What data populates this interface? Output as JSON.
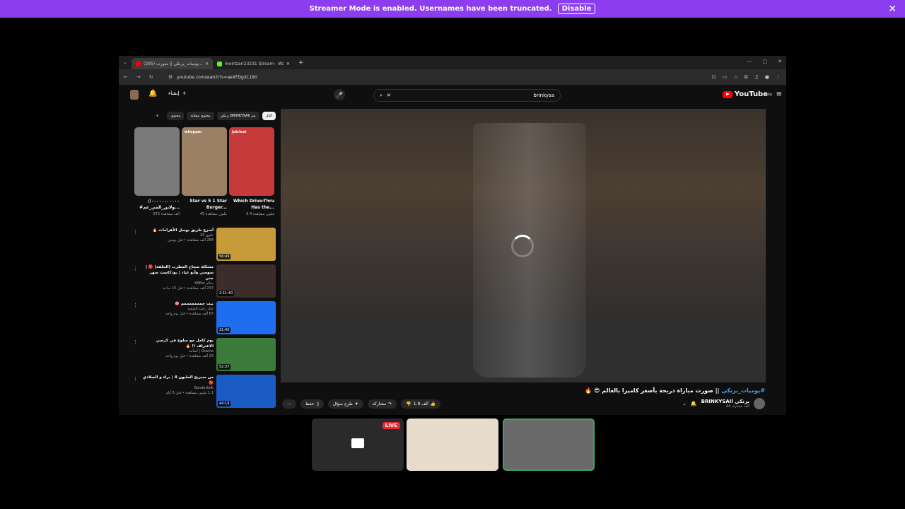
{
  "banner": {
    "text": "Streamer Mode is enabled. Usernames have been truncated.",
    "button": "Disable",
    "close": "✕",
    "color": "#8d3df0"
  },
  "browser": {
    "tabs": [
      {
        "title": "(295) يوميات_برنكي || صورت...",
        "icon_color": "#ff0000"
      },
      {
        "title": "montzari23231 Stream - Wa...",
        "icon_color": "#53fc18"
      }
    ],
    "new_tab": "+",
    "url": "youtube.com/watch?v=aeXFDgXL190",
    "controls": {
      "minimize": "—",
      "maximize": "▢",
      "close": "✕"
    }
  },
  "youtube": {
    "logo": "YouTube",
    "logo_sup": "SA",
    "search_query": "brinkysa",
    "create_label": "إنشاء",
    "notif_count": "9+",
    "chips": [
      "الكل",
      "من BRINKYSAIl برنكي",
      "محتوى مشابه",
      "محتوى"
    ],
    "shorts": [
      {
        "label": "",
        "title": "//۰۰۰۰۰۰۰۰۰۰۰ #ولاين_المي_عم...",
        "views": "872 ألف مشاهدة",
        "color": "#7a7a7a"
      },
      {
        "label": "whopper",
        "title": "Star vs 5 1 Star Burger...",
        "views": "45 مليون مشاهدة",
        "color": "#9c8063"
      },
      {
        "label": "Juiciest",
        "title": "Which Drive-Thru Has the...",
        "views": "5.4 مليون مشاهدة",
        "color": "#c63a3a"
      }
    ],
    "videos": [
      {
        "title": "أسرع طريق يوصل الأهرامات 🔥",
        "channel": "علوي 25",
        "stats": "284 ألف مشاهدة • قبل يومين",
        "duration": "56:49",
        "color": "#c79a3a"
      },
      {
        "title": "مشكلة سجاج المطرب (الحلقة) 🔴 | سوسي وأبو عياد | بودكاست سهر جني",
        "channel": "سالم XBEar",
        "stats": "237 ألف مشاهدة • قبل 15 ساعة",
        "duration": "2:11:40",
        "color": "#3a2d2a"
      },
      {
        "title": "بيت جمممممممم 🎯",
        "channel": "ملك راشد الشعوذ",
        "stats": "67 ألف مشاهدة • قبل يوم واحد",
        "duration": "21:45",
        "color": "#1f6ef0"
      },
      {
        "title": "يوم كامل مع سلوح في كرسي الاعتراف !! 🔥",
        "channel": "Osama | أسامة",
        "stats": "23 ألف مشاهدة • قبل يوم واحد",
        "duration": "52:37",
        "color": "#3b7a3a"
      },
      {
        "title": "من سيربح المليون 4 | براء و الصلادي 🔴",
        "channel": "Bandertalk",
        "stats": "1.1 مليون مشاهدة • قبل 6 أيام",
        "duration": "44:19",
        "color": "#1b5bc4"
      }
    ],
    "video_title_tag": "#يوميات_برنكي",
    "video_title": "|| صورت مباراة دربحة بأصغر كاميرا بالعالم 😎 🔥",
    "channel_name": "BRINKYSAIl برنكي",
    "subscribers": "44 ألف مشترك",
    "likes": "1.9 ألف",
    "share": "مشاركة",
    "ask": "طرح سؤال",
    "save": "حفظ"
  },
  "dock": {
    "live_badge": "LIVE"
  }
}
